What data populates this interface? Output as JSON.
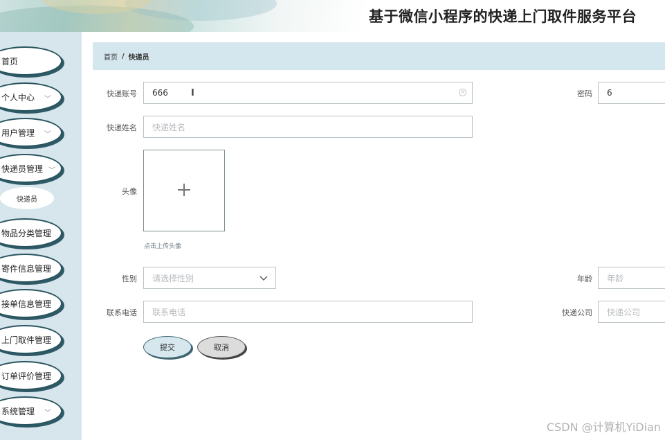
{
  "header": {
    "title": "基于微信小程序的快递上门取件服务平台"
  },
  "sidebar": {
    "items": [
      {
        "label": "首页",
        "has_chevron": false
      },
      {
        "label": "个人中心",
        "has_chevron": true
      },
      {
        "label": "用户管理",
        "has_chevron": true
      },
      {
        "label": "快递员管理",
        "has_chevron": true
      },
      {
        "label": "物品分类管理",
        "has_chevron": false
      },
      {
        "label": "寄件信息管理",
        "has_chevron": false
      },
      {
        "label": "接单信息管理",
        "has_chevron": false
      },
      {
        "label": "上门取件管理",
        "has_chevron": false
      },
      {
        "label": "订单评价管理",
        "has_chevron": false
      },
      {
        "label": "系统管理",
        "has_chevron": true
      }
    ],
    "submenu": {
      "label": "快递员"
    }
  },
  "breadcrumb": {
    "home": "首页",
    "separator": "/",
    "current": "快递员"
  },
  "form": {
    "account": {
      "label": "快递账号",
      "value": "666"
    },
    "password": {
      "label": "密码",
      "value": "6"
    },
    "name": {
      "label": "快递姓名",
      "placeholder": "快递姓名"
    },
    "avatar": {
      "label": "头像",
      "tip": "点击上传头像"
    },
    "gender": {
      "label": "性别",
      "placeholder": "请选择性别"
    },
    "age": {
      "label": "年龄",
      "placeholder": "年龄"
    },
    "phone": {
      "label": "联系电话",
      "placeholder": "联系电话"
    },
    "company": {
      "label": "快递公司",
      "placeholder": "快递公司"
    },
    "submit_label": "提交",
    "cancel_label": "取消"
  },
  "watermark": "CSDN @计算机YiDian",
  "colors": {
    "sidebar_bg": "#d7e6ec",
    "breadcrumb_bg": "#d5e7ee",
    "accent_border": "#2a5560"
  }
}
